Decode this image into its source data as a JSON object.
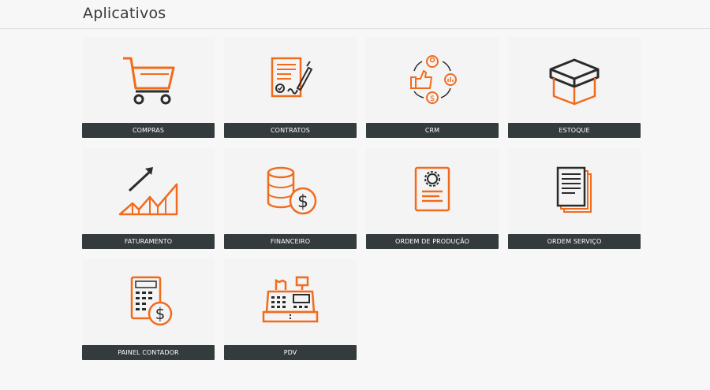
{
  "header": {
    "title": "Aplicativos"
  },
  "apps": [
    {
      "label": "COMPRAS",
      "icon": "shopping-cart-icon"
    },
    {
      "label": "CONTRATOS",
      "icon": "contract-signature-icon"
    },
    {
      "label": "CRM",
      "icon": "crm-cycle-icon"
    },
    {
      "label": "ESTOQUE",
      "icon": "box-icon"
    },
    {
      "label": "FATURAMENTO",
      "icon": "growth-chart-icon"
    },
    {
      "label": "FINANCEIRO",
      "icon": "coins-dollar-icon"
    },
    {
      "label": "ORDEM DE PRODUÇÃO",
      "icon": "production-gear-document-icon"
    },
    {
      "label": "ORDEM SERVIÇO",
      "icon": "stacked-documents-icon"
    },
    {
      "label": "PAINEL CONTADOR",
      "icon": "calculator-dollar-icon"
    },
    {
      "label": "PDV",
      "icon": "cash-register-icon"
    }
  ],
  "colors": {
    "accent": "#f26b1d",
    "dark": "#2b2b2b",
    "label_bg": "#343b3d"
  }
}
